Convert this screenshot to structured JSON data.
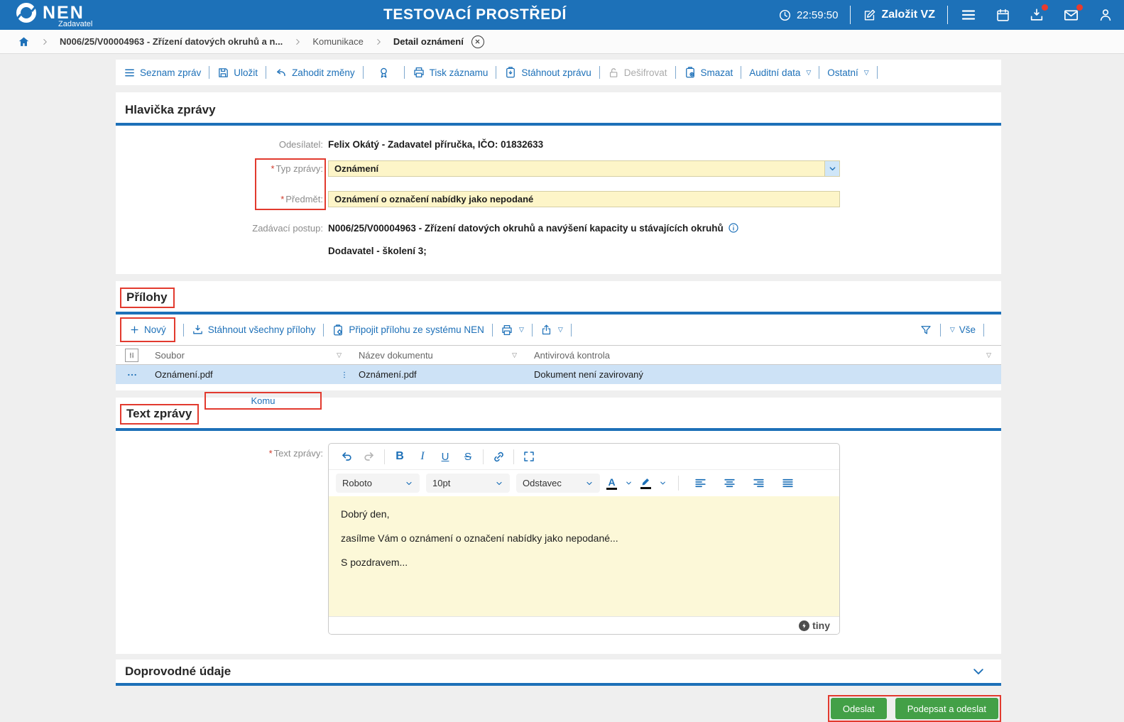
{
  "colors": {
    "header_blue": "#1d71b8",
    "link_blue": "#1d70b8",
    "field_yellow": "#fdf5c8",
    "editor_yellow": "#fcf8d8",
    "selected_row_blue": "#cde2f6",
    "green_button": "#43a047",
    "annotation_red": "#e23a2e",
    "notification_red": "#e83b2d"
  },
  "icons": {
    "caret_down_outline": "▽",
    "ellipsis_row": "•••"
  },
  "misc": {
    "required_mark": "*"
  },
  "header": {
    "brand": "NEN",
    "brand_sub": "Zadavatel",
    "env_title": "TESTOVACÍ PROSTŘEDÍ",
    "clock": "22:59:50",
    "create_button": "Založit VZ"
  },
  "breadcrumb": {
    "items": [
      "N006/25/V00004963 - Zřízení datových okruhů a n...",
      "Komunikace",
      "Detail oznámení"
    ]
  },
  "toolbar": {
    "seznam_zprav": "Seznam zpráv",
    "ulozit": "Uložit",
    "zahodit_zmeny": "Zahodit změny",
    "tisk_zaznamu": "Tisk záznamu",
    "stahnout_zpravu": "Stáhnout zprávu",
    "desifrovat": "Dešifrovat",
    "smazat": "Smazat",
    "auditni_data": "Auditní data",
    "ostatni": "Ostatní"
  },
  "message_header": {
    "section_title": "Hlavička zprávy",
    "odesilatel_label": "Odesílatel:",
    "odesilatel_value": "Felix Okátý - Zadavatel příručka, IČO: 01832633",
    "typ_zpravy_label": "Typ zprávy:",
    "typ_zpravy_value": "Oznámení",
    "predmet_label": "Předmět:",
    "predmet_value": "Oznámení o označení nabídky jako nepodané",
    "zadavaci_postup_label": "Zadávací postup:",
    "zadavaci_postup_value": "N006/25/V00004963 - Zřízení datových okruhů a navýšení kapacity u stávajících okruhů",
    "komu_label": "Komu",
    "komu_value": "Dodavatel - školení 3;"
  },
  "attachments": {
    "section_title": "Přílohy",
    "novy": "Nový",
    "stahnout_vsechny": "Stáhnout všechny přílohy",
    "pripojit": "Připojit přílohu ze systému NEN",
    "vse": "Vše",
    "columns": [
      "Soubor",
      "Název dokumentu",
      "Antivirová kontrola"
    ],
    "rows": [
      {
        "soubor": "Oznámení.pdf",
        "nazev": "Oznámení.pdf",
        "antivir": "Dokument není zavirovaný"
      }
    ]
  },
  "message_text": {
    "section_title": "Text zprávy",
    "label": "Text zprávy:",
    "editor": {
      "font": "Roboto",
      "size": "10pt",
      "block": "Odstavec",
      "paragraphs": [
        "Dobrý den,",
        "zasílme Vám o oznámení o označení nabídky jako nepodané...",
        "S pozdravem..."
      ],
      "brand": "tiny"
    }
  },
  "additional": {
    "section_title": "Doprovodné údaje"
  },
  "actions": {
    "odeslat": "Odeslat",
    "podepsat_a_odeslat": "Podepsat a odeslat"
  }
}
